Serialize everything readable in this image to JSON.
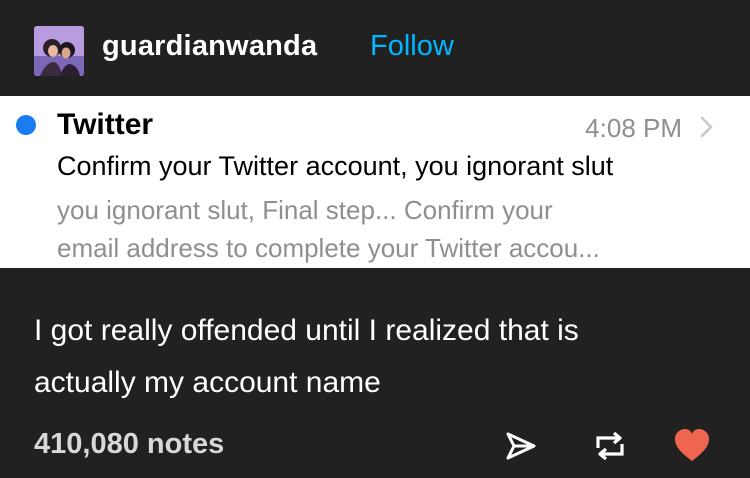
{
  "post": {
    "username": "guardianwanda",
    "follow_label": "Follow",
    "notification": {
      "sender": "Twitter",
      "time": "4:08 PM",
      "subject": "Confirm your Twitter account, you ignorant slut",
      "preview_line1": "you ignorant slut, Final step... Confirm your",
      "preview_line2": "email address to complete your Twitter accou..."
    },
    "body_line1": "I got really offended until I realized that is",
    "body_line2": "actually my account name",
    "notes": "410,080 notes"
  },
  "icons": {
    "avatar": "avatar-image",
    "share": "share-icon",
    "reblog": "reblog-icon",
    "like": "heart-icon",
    "unread": "unread-dot-icon",
    "chevron": "chevron-right-icon"
  },
  "colors": {
    "background": "#212121",
    "follow": "#00b8ff",
    "unread_dot": "#1a7cf0",
    "heart": "#ee6550"
  }
}
